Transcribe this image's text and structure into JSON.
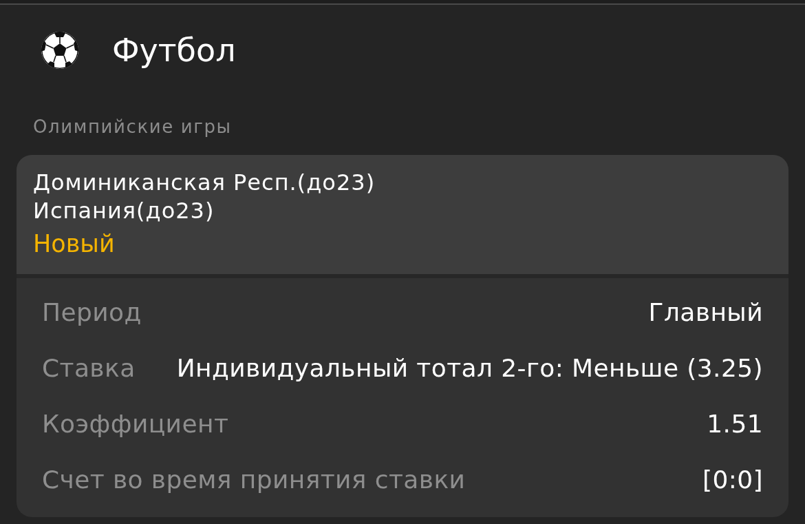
{
  "header": {
    "title": "Футбол"
  },
  "tournament": "Олимпийские игры",
  "event": {
    "teams": [
      "Доминиканская Респ.(до23)",
      "Испания(до23)"
    ],
    "status": "Новый"
  },
  "details": [
    {
      "label": "Период",
      "value": "Главный"
    },
    {
      "label": "Ставка",
      "value": "Индивидуальный тотал 2-го: Меньше (3.25)"
    },
    {
      "label": "Коэффициент",
      "value": "1.51"
    },
    {
      "label": "Счет во время принятия ставки",
      "value": "[0:0]"
    }
  ]
}
